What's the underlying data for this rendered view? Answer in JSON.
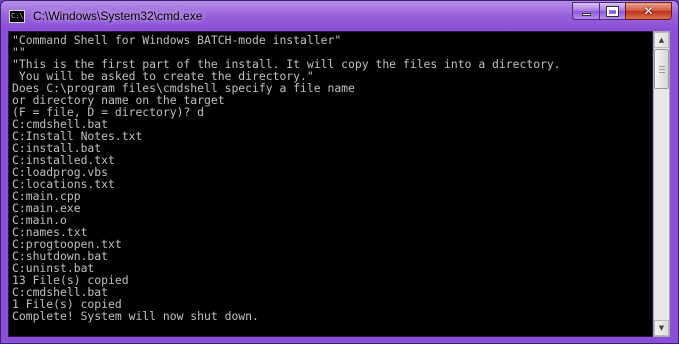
{
  "window": {
    "title": "C:\\Windows\\System32\\cmd.exe",
    "icon": "cmd-icon",
    "icon_text": "C:\\",
    "accent": "#8a4fd6"
  },
  "caption_buttons": {
    "minimize": "minimize-icon",
    "maximize": "maximize-icon",
    "close_glyph": "✕"
  },
  "console": {
    "background": "#000000",
    "foreground": "#c0c0c0",
    "lines": [
      "\"Command Shell for Windows BATCH-mode installer\"",
      "\"\"",
      "\"This is the first part of the install. It will copy the files into a directory.",
      " You will be asked to create the directory.\"",
      "Does C:\\program files\\cmdshell specify a file name",
      "or directory name on the target",
      "(F = file, D = directory)? d",
      "C:cmdshell.bat",
      "C:Install Notes.txt",
      "C:install.bat",
      "C:installed.txt",
      "C:loadprog.vbs",
      "C:locations.txt",
      "C:main.cpp",
      "C:main.exe",
      "C:main.o",
      "C:names.txt",
      "C:progtoopen.txt",
      "C:shutdown.bat",
      "C:uninst.bat",
      "13 File(s) copied",
      "C:cmdshell.bat",
      "1 File(s) copied",
      "Complete! System will now shut down."
    ]
  },
  "scrollbar": {
    "up_arrow": "▲",
    "down_arrow": "▼",
    "position": 0.0
  }
}
